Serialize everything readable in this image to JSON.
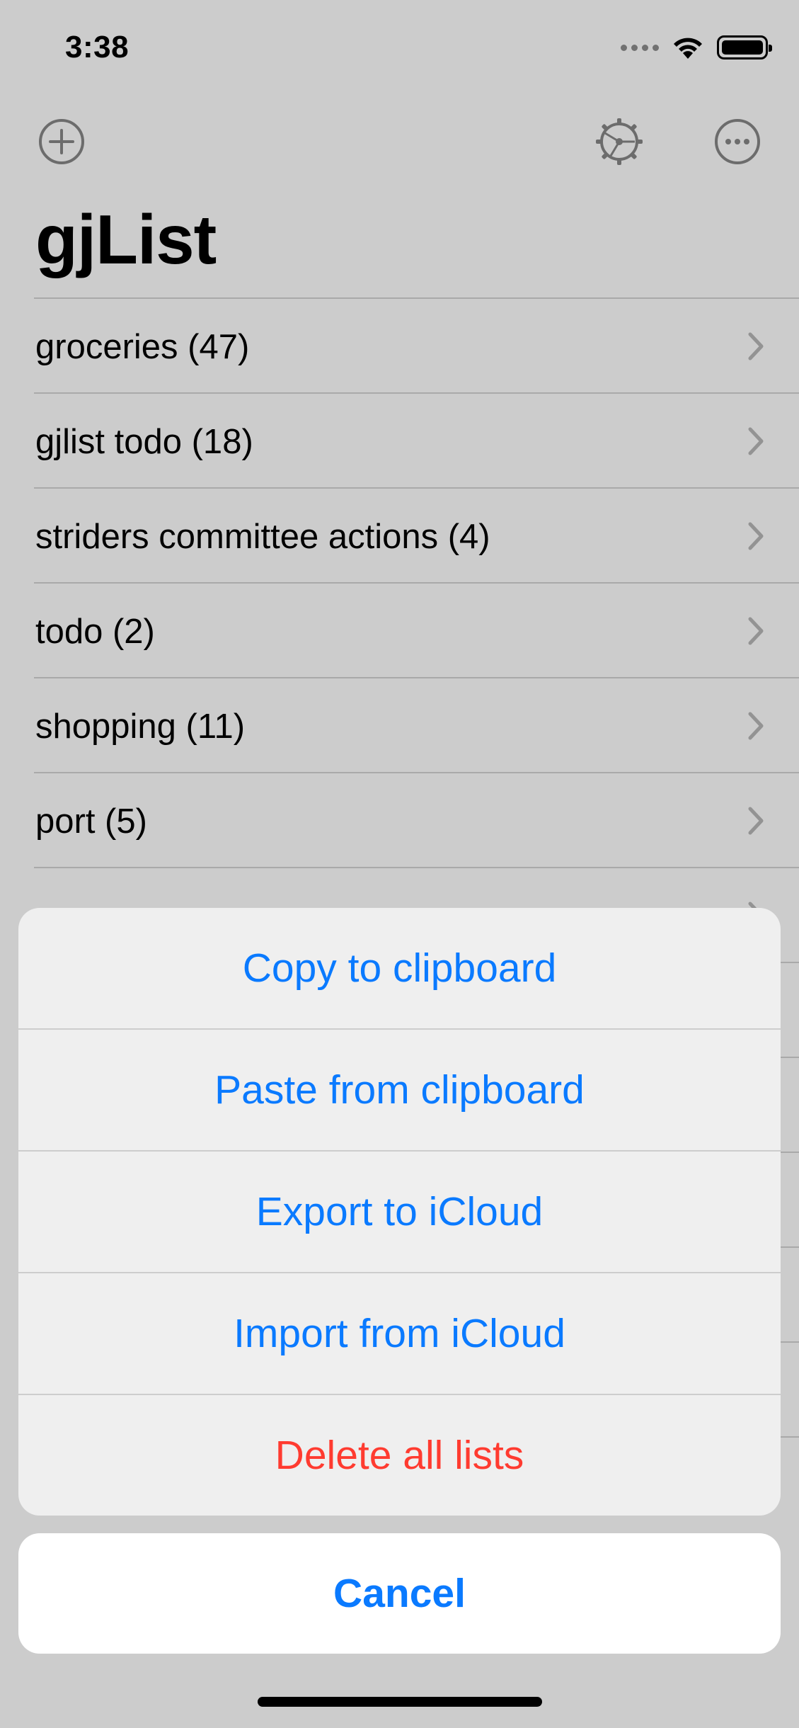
{
  "status_bar": {
    "time": "3:38"
  },
  "nav": {
    "add_icon": "plus-circle-icon",
    "settings_icon": "gear-icon",
    "more_icon": "ellipsis-circle-icon"
  },
  "title": "gjList",
  "lists": [
    {
      "label": "groceries (47)"
    },
    {
      "label": "gjlist todo (18)"
    },
    {
      "label": "striders committee actions (4)"
    },
    {
      "label": "todo (2)"
    },
    {
      "label": "shopping (11)"
    },
    {
      "label": "port (5)"
    },
    {
      "label": ""
    },
    {
      "label": ""
    },
    {
      "label": ""
    },
    {
      "label": ""
    },
    {
      "label": ""
    },
    {
      "label": ""
    },
    {
      "label": ""
    }
  ],
  "action_sheet": {
    "copy": "Copy to clipboard",
    "paste": "Paste from clipboard",
    "export": "Export to iCloud",
    "import": "Import from iCloud",
    "delete": "Delete all lists",
    "cancel": "Cancel"
  },
  "colors": {
    "accent": "#0a7aff",
    "destructive": "#ff3b30",
    "overlay": "rgba(0,0,0,0.2)"
  }
}
